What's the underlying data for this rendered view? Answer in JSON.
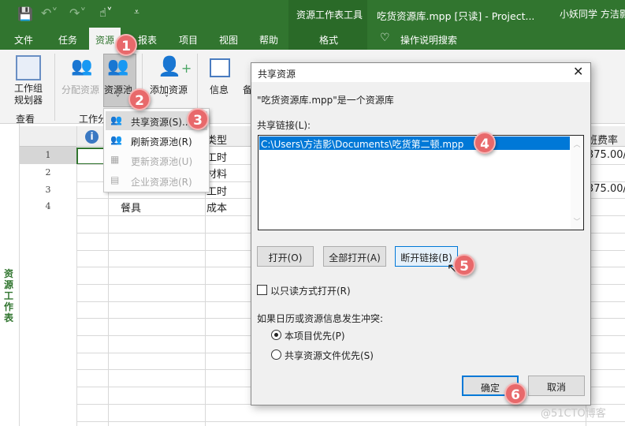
{
  "titlebar": {
    "context_tab": "资源工作表工具",
    "doc_title": "吃货资源库.mpp [只读]  -  Project...",
    "user": "小妖同学 方洁影",
    "icons": [
      "save-icon",
      "undo-icon",
      "redo-icon",
      "touch-mode-icon",
      "customize-qat-icon"
    ]
  },
  "tabs": [
    "文件",
    "任务",
    "资源",
    "报表",
    "项目",
    "视图",
    "帮助"
  ],
  "selected_tab": "资源",
  "context_subtab": "格式",
  "tell_me": "操作说明搜索",
  "ribbon": {
    "team_planner": "工作组\n规划器",
    "team_planner_l1": "工作组",
    "team_planner_l2": "规划器",
    "view_group": "查看",
    "assign": "分配资源",
    "pool": "资源池",
    "add": "添加资源",
    "info": "信息",
    "notes_partial": "备",
    "group_partial": "工作分"
  },
  "menu": {
    "items": [
      {
        "label": "共享资源(S)...",
        "enabled": true
      },
      {
        "label": "刷新资源池(R)",
        "enabled": true
      },
      {
        "label": "更新资源池(U)",
        "enabled": false
      },
      {
        "label": "企业资源池(R)",
        "enabled": false
      }
    ]
  },
  "sheet": {
    "side_label": "资源工作表",
    "type_header": "类型",
    "rate_header": "班费率",
    "rows": [
      {
        "n": "1",
        "name": "",
        "type": "工时",
        "rate": "375.00/"
      },
      {
        "n": "2",
        "name": "",
        "type": "材料",
        "rate": ""
      },
      {
        "n": "3",
        "name": "",
        "type": "工时",
        "rate": "375.00/"
      },
      {
        "n": "4",
        "name": "餐具",
        "type": "成本",
        "rate": ""
      }
    ]
  },
  "dialog": {
    "title": "共享资源",
    "desc": "\"吃货资源库.mpp\"是一个资源库",
    "links_label": "共享链接(L):",
    "links": [
      "C:\\Users\\方洁影\\Documents\\吃货第二顿.mpp"
    ],
    "open": "打开(O)",
    "open_all": "全部打开(A)",
    "break_link": "断开链接(B)",
    "readonly": "以只读方式打开(R)",
    "readonly_checked": false,
    "conflict_label": "如果日历或资源信息发生冲突:",
    "radio_project": "本项目优先(P)",
    "radio_shared": "共享资源文件优先(S)",
    "selected_radio": "本项目优先(P)",
    "ok": "确定",
    "cancel": "取消"
  },
  "badges": [
    "1",
    "2",
    "3",
    "4",
    "5",
    "6"
  ],
  "watermark": "@51CTO博客",
  "colors": {
    "brand": "#31752f",
    "badge": "#e8696b",
    "selection": "#0078d7"
  }
}
